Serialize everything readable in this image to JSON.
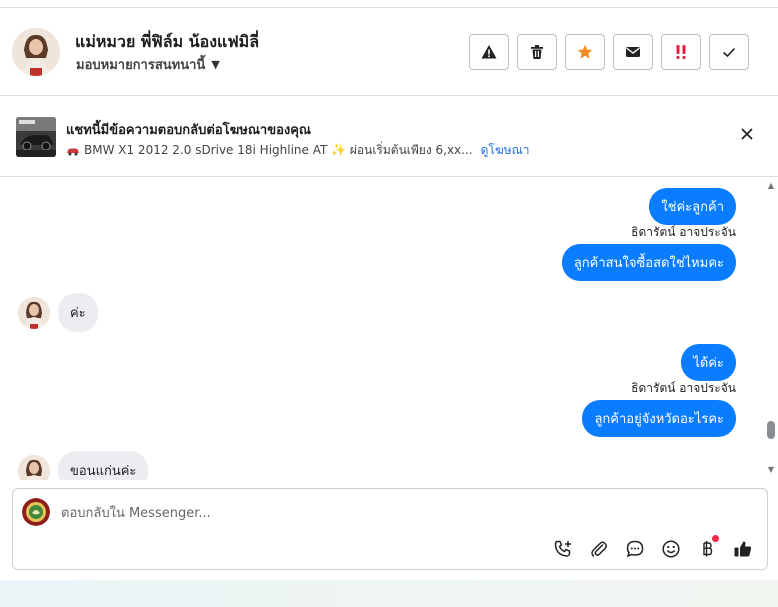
{
  "header": {
    "contact_name": "แม่หมวย พี่ฟิล์ม น้องแฟมิลี่",
    "assign_label": "มอบหมายการสนทนานี้"
  },
  "ad": {
    "title": "แชทนี้มีข้อความตอบกลับต่อโฆษณาของคุณ",
    "subtitle": "BMW X1 2012 2.0 sDrive 18i Highline AT ✨ ผ่อนเริ่มต้นเพียง 6,xx...",
    "link": "ดูโฆษณา"
  },
  "messages": {
    "m1": "ใช่ค่ะลูกค้า",
    "sender1": "ธิดารัตน์ อาจประจัน",
    "m2": "ลูกค้าสนใจซื้อสดใช่ไหมคะ",
    "in1": "ค่ะ",
    "m3": "ได้ค่ะ",
    "sender2": "ธิดารัตน์ อาจประจัน",
    "m4": "ลูกค้าอยู่จังหวัดอะไรคะ",
    "in2": "ขอนแก่นค่ะ"
  },
  "composer": {
    "placeholder": "ตอบกลับใน Messenger..."
  },
  "colors": {
    "accent": "#0a7cff",
    "star": "#f28b20",
    "alert": "#e41e3f"
  }
}
